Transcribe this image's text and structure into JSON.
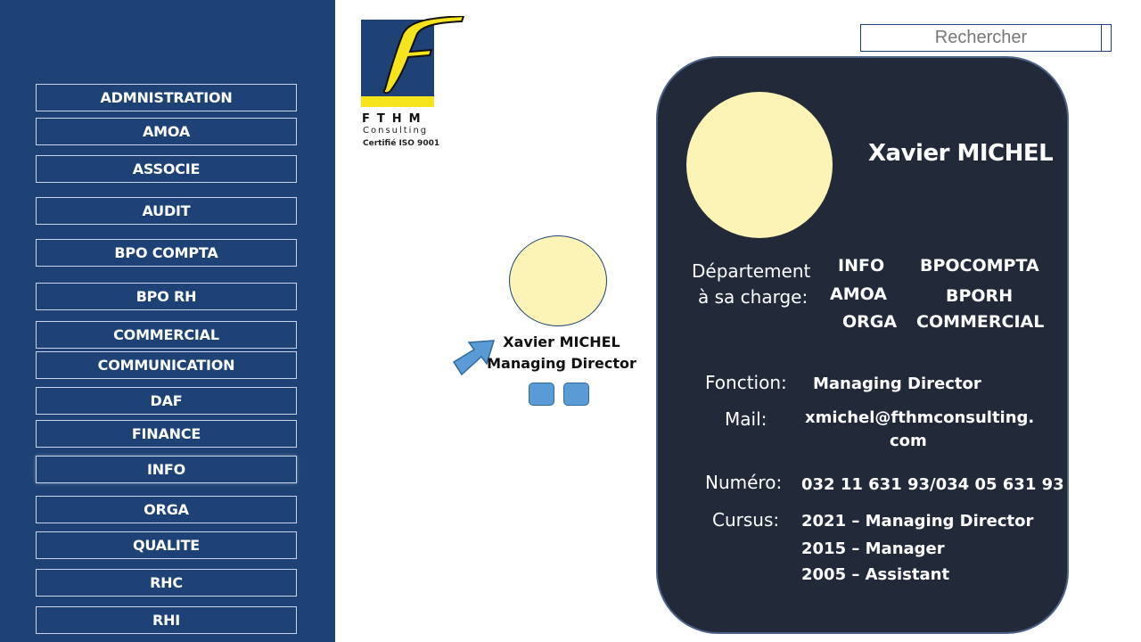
{
  "sidebar": {
    "items": [
      {
        "label": "ADMNISTRATION"
      },
      {
        "label": "AMOA"
      },
      {
        "label": "ASSOCIE"
      },
      {
        "label": "AUDIT"
      },
      {
        "label": "BPO COMPTA"
      },
      {
        "label": "BPO RH"
      },
      {
        "label": "COMMERCIAL"
      },
      {
        "label": "COMMUNICATION"
      },
      {
        "label": "DAF"
      },
      {
        "label": "FINANCE"
      },
      {
        "label": "INFO"
      },
      {
        "label": "ORGA"
      },
      {
        "label": "QUALITE"
      },
      {
        "label": "RHC"
      },
      {
        "label": "RHI"
      }
    ]
  },
  "logo": {
    "letters": "FTHM",
    "consulting": "Consulting",
    "cert": "Certifié ISO 9001"
  },
  "search": {
    "placeholder": "Rechercher"
  },
  "org_node": {
    "name": "Xavier MICHEL",
    "title": "Managing Director"
  },
  "card": {
    "name": "Xavier MICHEL",
    "department_label_1": "Département",
    "department_label_2": "à sa charge:",
    "departments": {
      "info": "INFO",
      "bpocompta": "BPOCOMPTA",
      "amoa": "AMOA",
      "bporh": "BPORH",
      "orga": "ORGA",
      "commercial": "COMMERCIAL"
    },
    "fonction_label": "Fonction:",
    "fonction_value": "Managing Director",
    "mail_label": "Mail:",
    "mail_value_1": "xmichel@fthmconsulting.",
    "mail_value_2": "com",
    "numero_label": "Numéro:",
    "numero_value": "032 11 631 93/034 05 631 93",
    "cursus_label": "Cursus:",
    "cursus": [
      "2021 – Managing Director",
      "2015 – Manager",
      "2005 – Assistant"
    ]
  },
  "colors": {
    "sidebar_bg": "#1e4275",
    "card_bg": "#222a3a",
    "avatar_fill": "#fbf4b6",
    "accent_blue": "#5b9bd5",
    "logo_yellow": "#f5e31c"
  }
}
